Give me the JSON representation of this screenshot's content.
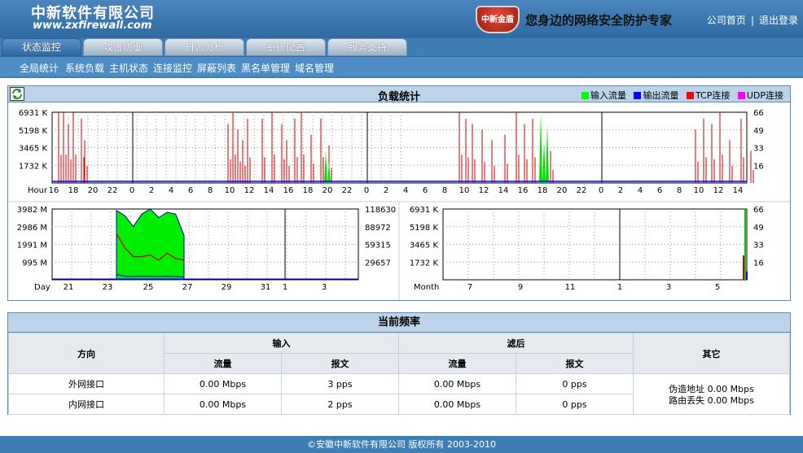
{
  "header": {
    "company_name": "中新软件有限公司",
    "website": "www.zxfirewall.com",
    "brand_badge": "中新金盾",
    "slogan": "您身边的网络安全防护专家",
    "links": {
      "home": "公司首页",
      "separator": "|",
      "logout": "退出登录"
    }
  },
  "tabs": [
    {
      "label": "状态监控",
      "active": true
    },
    {
      "label": "攻击防御",
      "active": false
    },
    {
      "label": "日志分析",
      "active": false
    },
    {
      "label": "系统配置",
      "active": false
    },
    {
      "label": "服务支持",
      "active": false
    }
  ],
  "subnav": [
    "全局统计",
    "系统负载",
    "主机状态",
    "连接监控",
    "屏蔽列表",
    "黑名单管理",
    "域名管理"
  ],
  "load_panel": {
    "title": "负载统计",
    "legend": [
      {
        "label": "输入流量",
        "color": "#00ff00"
      },
      {
        "label": "输出流量",
        "color": "#0000ff"
      },
      {
        "label": "TCP连接",
        "color": "#ff0000"
      },
      {
        "label": "UDP连接",
        "color": "#ff00ff"
      }
    ]
  },
  "chart_data": [
    {
      "type": "line",
      "title": "",
      "xlabel": "Hour",
      "x": [
        "16",
        "18",
        "20",
        "22",
        "0",
        "2",
        "4",
        "6",
        "8",
        "10",
        "12",
        "14",
        "16",
        "18",
        "20",
        "22",
        "0",
        "2",
        "4",
        "6",
        "8",
        "10",
        "12",
        "14",
        "16",
        "18",
        "20",
        "22",
        "0",
        "2",
        "4",
        "6",
        "8",
        "10",
        "12",
        "14"
      ],
      "y_left_ticks": [
        "6931 K",
        "5198 K",
        "3465 K",
        "1732 K"
      ],
      "y_right_ticks": [
        "66",
        "49",
        "33",
        "16"
      ],
      "series": [
        {
          "name": "TCP连接",
          "values": [
            1,
            66,
            66,
            1,
            55,
            5,
            2,
            2,
            2,
            50,
            60,
            50,
            66,
            60,
            55,
            40,
            30,
            2,
            2,
            2,
            2,
            2,
            66,
            60,
            50,
            45,
            55,
            60,
            40,
            10,
            2,
            2,
            2,
            2,
            2,
            55,
            60,
            55,
            45,
            60,
            10
          ]
        },
        {
          "name": "输入流量",
          "values": [
            0,
            0,
            0,
            0,
            0,
            0,
            0,
            0,
            0,
            0,
            0,
            0,
            0,
            0,
            0,
            25,
            0,
            0,
            0,
            0,
            0,
            0,
            0,
            0,
            0,
            66,
            0,
            0,
            0,
            0,
            0,
            0,
            0,
            0,
            0,
            0,
            0,
            0,
            0,
            0,
            0
          ]
        },
        {
          "name": "输出流量",
          "values": [
            1,
            1,
            1,
            1,
            1,
            1,
            1,
            1,
            1,
            1,
            1,
            1,
            1,
            1,
            1,
            1,
            1,
            1,
            1,
            1,
            1,
            1,
            1,
            1,
            1,
            1,
            1,
            1,
            1,
            1,
            1,
            1,
            1,
            1,
            1,
            1,
            1,
            1,
            1,
            1,
            1
          ]
        }
      ]
    },
    {
      "type": "area",
      "title": "",
      "xlabel": "Day",
      "x": [
        "21",
        "23",
        "25",
        "27",
        "29",
        "31",
        "1",
        "3"
      ],
      "y_left_ticks": [
        "3982 M",
        "2986 M",
        "1991 M",
        "995 M"
      ],
      "y_right_ticks": [
        "118630",
        "88972",
        "59315",
        "29657"
      ],
      "series": [
        {
          "name": "输入流量",
          "values": [
            0,
            0,
            0,
            0,
            0,
            0,
            0,
            0,
            0,
            0,
            0,
            0,
            3900,
            3600,
            3000,
            3700,
            3982,
            3500,
            3800,
            3700,
            2500,
            0,
            0,
            0,
            0,
            0,
            0,
            0,
            0,
            0,
            0,
            0,
            0,
            0,
            0,
            0,
            0,
            0,
            0,
            0,
            0,
            0,
            0,
            0,
            0,
            0,
            0,
            0,
            0,
            0
          ]
        },
        {
          "name": "TCP连接",
          "values": [
            0,
            0,
            0,
            0,
            0,
            0,
            0,
            0,
            0,
            0,
            0,
            0,
            2600,
            1800,
            1300,
            1300,
            1400,
            1100,
            1500,
            1200,
            1100,
            0,
            0,
            0,
            0,
            0,
            0,
            0,
            0,
            0,
            0,
            0,
            0,
            0,
            0,
            0,
            0,
            0,
            0,
            0,
            0,
            0,
            0,
            0,
            0,
            0,
            0,
            0,
            0,
            0
          ]
        },
        {
          "name": "输出流量",
          "values": [
            0,
            0,
            0,
            0,
            0,
            0,
            0,
            0,
            0,
            0,
            0,
            0,
            300,
            200,
            180,
            200,
            200,
            180,
            200,
            180,
            160,
            0,
            0,
            0,
            0,
            0,
            0,
            0,
            0,
            0,
            0,
            0,
            0,
            0,
            0,
            0,
            0,
            0,
            0,
            0,
            0,
            0,
            0,
            0,
            0,
            0,
            0,
            0,
            0,
            0
          ]
        }
      ]
    },
    {
      "type": "line",
      "title": "",
      "xlabel": "Month",
      "x": [
        "7",
        "9",
        "11",
        "1",
        "3",
        "5"
      ],
      "y_left_ticks": [
        "6931 K",
        "5198 K",
        "3465 K",
        "1732 K"
      ],
      "y_right_ticks": [
        "66",
        "49",
        "33",
        "16"
      ],
      "series": [
        {
          "name": "输入流量",
          "values": [
            0,
            0,
            0,
            0,
            0,
            0,
            0,
            0,
            0,
            0,
            0,
            0,
            0,
            0,
            0,
            0,
            0,
            0,
            0,
            0,
            0,
            0,
            0,
            0,
            0,
            0,
            0,
            0,
            0,
            66
          ]
        },
        {
          "name": "TCP连接",
          "values": [
            0,
            0,
            0,
            0,
            0,
            0,
            0,
            0,
            0,
            0,
            0,
            0,
            0,
            0,
            0,
            0,
            0,
            0,
            0,
            0,
            0,
            0,
            0,
            0,
            0,
            0,
            0,
            0,
            0,
            22
          ]
        }
      ]
    }
  ],
  "frequency": {
    "title": "当前频率",
    "headers": {
      "direction": "方向",
      "input": "输入",
      "filtered": "滤后",
      "other": "其它",
      "traffic": "流量",
      "packets": "报文"
    },
    "rows": [
      {
        "direction": "外网接口",
        "in_traffic": "0.00 Mbps",
        "in_packets": "3 pps",
        "out_traffic": "0.00 Mbps",
        "out_packets": "0 pps"
      },
      {
        "direction": "内网接口",
        "in_traffic": "0.00 Mbps",
        "in_packets": "2 pps",
        "out_traffic": "0.00 Mbps",
        "out_packets": "0 pps"
      }
    ],
    "other": {
      "spoofed_label": "伪造地址",
      "spoofed_value": "0.00 Mbps",
      "route_loss_label": "路由丢失",
      "route_loss_value": "0.00 Mbps"
    }
  },
  "footer": "©安徽中新软件有限公司 版权所有 2003-2010"
}
